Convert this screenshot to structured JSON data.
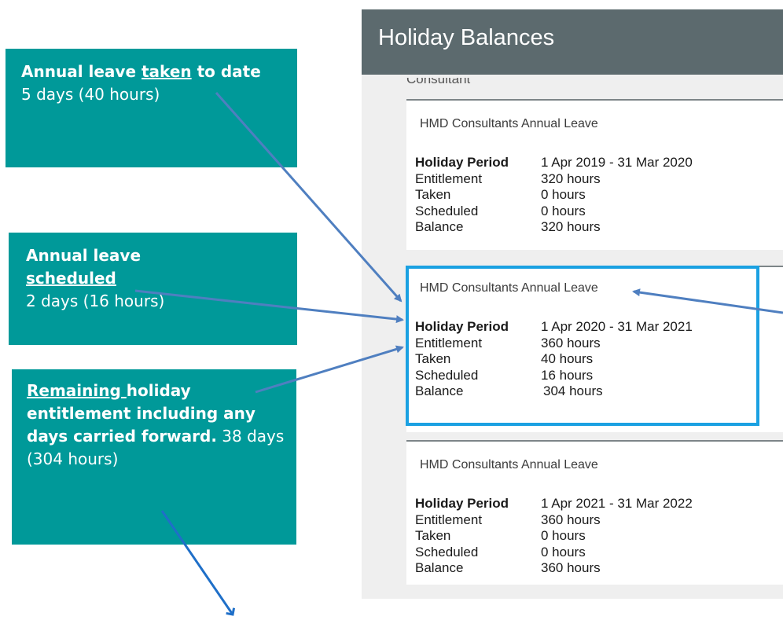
{
  "app": {
    "title": "Holiday Balances",
    "section_label": "Consultant"
  },
  "cards": [
    {
      "title": "HMD Consultants Annual Leave",
      "period_label": "Holiday Period",
      "period": "1 Apr 2019 - 31 Mar 2020",
      "entitlement_label": "Entitlement",
      "entitlement": "320 hours",
      "taken_label": "Taken",
      "taken": "0 hours",
      "scheduled_label": "Scheduled",
      "scheduled": "0 hours",
      "balance_label": "Balance",
      "balance": "320 hours"
    },
    {
      "title": "HMD Consultants Annual Leave",
      "period_label": "Holiday Period",
      "period": "1 Apr 2020 - 31 Mar 2021",
      "entitlement_label": "Entitlement",
      "entitlement": "360 hours",
      "taken_label": "Taken",
      "taken": "40 hours",
      "scheduled_label": "Scheduled",
      "scheduled": "16 hours",
      "balance_label": "Balance",
      "balance": "304 hours"
    },
    {
      "title": "HMD Consultants Annual Leave",
      "period_label": "Holiday Period",
      "period": "1 Apr 2021 - 31 Mar 2022",
      "entitlement_label": "Entitlement",
      "entitlement": "360 hours",
      "taken_label": "Taken",
      "taken": "0 hours",
      "scheduled_label": "Scheduled",
      "scheduled": "0 hours",
      "balance_label": "Balance",
      "balance": "360 hours"
    }
  ],
  "callouts": {
    "taken": {
      "bold_pre": "Annual leave ",
      "bold_underlined": "taken",
      "bold_post": " to date",
      "detail": "5 days (40 hours)"
    },
    "scheduled": {
      "bold_pre": "Annual leave ",
      "bold_underlined": "scheduled",
      "detail": "2 days (16 hours)"
    },
    "remaining": {
      "bold_underlined": "Remaining ",
      "bold_post": "holiday entitlement including any days carried forward.",
      "detail": " 38 days (304 hours)"
    }
  },
  "colors": {
    "callout_bg": "#009999",
    "header_bg": "#5c6a6e",
    "highlight_border": "#1ba1e2",
    "arrow": "#4f7fc0"
  }
}
